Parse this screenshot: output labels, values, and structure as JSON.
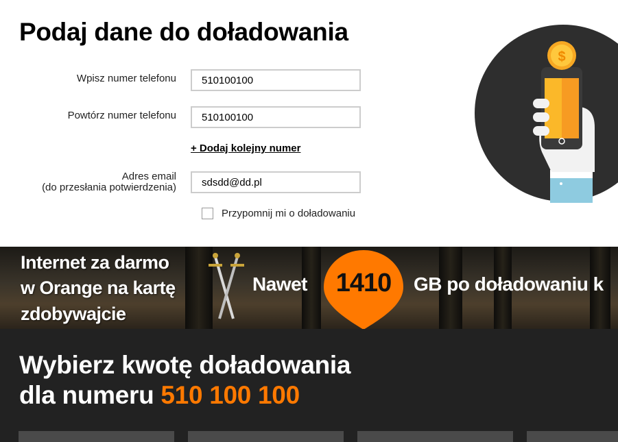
{
  "form": {
    "title": "Podaj dane do doładowania",
    "phone_label": "Wpisz numer telefonu",
    "phone_value": "510100100",
    "repeat_label": "Powtórz numer telefonu",
    "repeat_value": "510100100",
    "add_number_link": "+ Dodaj kolejny numer",
    "email_label_line1": "Adres email",
    "email_label_line2": "(do przesłania potwierdzenia)",
    "email_value": "sdsdd@dd.pl",
    "reminder_label": "Przypomnij mi o doładowaniu",
    "reminder_checked": false
  },
  "banner": {
    "line1": "Internet za darmo",
    "line2": "w Orange na kartę",
    "line3": "zdobywajcie",
    "nawet": "Nawet",
    "amount": "1410",
    "gb_text": "GB po doładowaniu k"
  },
  "amount_section": {
    "title_line1": "Wybierz kwotę doładowania",
    "title_prefix": "dla numeru",
    "number": "510 100 100"
  },
  "colors": {
    "accent": "#ff7900",
    "dark_bg": "#222222",
    "input_border": "#cccccc"
  },
  "icons": [
    "coin-icon",
    "smartphone-hand-icon",
    "swords-icon",
    "location-pin-icon"
  ]
}
